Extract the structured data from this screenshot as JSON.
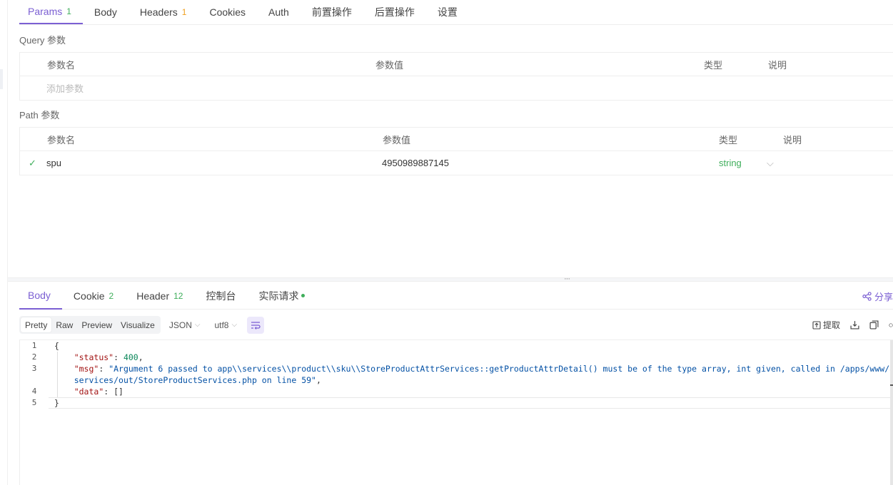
{
  "request_tabs": [
    {
      "label": "Params",
      "count": "1"
    },
    {
      "label": "Body"
    },
    {
      "label": "Headers",
      "count": "1"
    },
    {
      "label": "Cookies"
    },
    {
      "label": "Auth"
    },
    {
      "label": "前置操作"
    },
    {
      "label": "后置操作"
    },
    {
      "label": "设置"
    }
  ],
  "query": {
    "label": "Query 参数",
    "columns": [
      "参数名",
      "参数值",
      "类型",
      "说明"
    ],
    "add_placeholder": "添加参数"
  },
  "path": {
    "label": "Path 参数",
    "columns": [
      "参数名",
      "参数值",
      "类型",
      "说明"
    ],
    "rows": [
      {
        "name": "spu",
        "value": "4950989887145",
        "type": "string"
      }
    ]
  },
  "response_tabs": [
    {
      "label": "Body"
    },
    {
      "label": "Cookie",
      "count": "2"
    },
    {
      "label": "Header",
      "count": "12"
    },
    {
      "label": "控制台"
    },
    {
      "label": "实际请求"
    }
  ],
  "share_label": "分享",
  "view_modes": [
    "Pretty",
    "Raw",
    "Preview",
    "Visualize"
  ],
  "format_select": "JSON",
  "encoding_select": "utf8",
  "extract_label": "提取",
  "code": {
    "line_numbers": [
      "1",
      "2",
      "3",
      "",
      "4",
      "5"
    ],
    "open_brace": "{",
    "status_key": "\"status\"",
    "status_val": "400",
    "msg_key": "\"msg\"",
    "msg_val_1": "\"Argument 6 passed to app\\\\services\\\\product\\\\sku\\\\StoreProductAttrServices::getProductAttrDetail() must be of the type array, int given, called in /apps/www/app/",
    "msg_val_2": "services/out/StoreProductServices.php on line 59\"",
    "data_key": "\"data\"",
    "data_val": "[]",
    "close_brace": "}"
  },
  "colors": {
    "accent": "#7b5fd3",
    "success": "#3fae5b",
    "warn": "#f0a020"
  }
}
